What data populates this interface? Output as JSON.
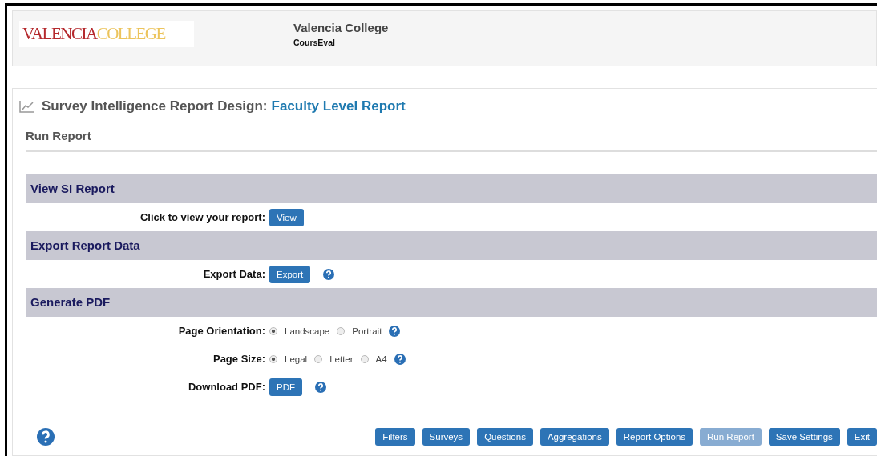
{
  "header": {
    "logo": [
      {
        "text": "VALENCIA",
        "color": "#b5292d"
      },
      {
        "text": "COLLEGE",
        "color": "#ecc45c"
      }
    ],
    "title": "Valencia College",
    "subtitle": "CoursEval"
  },
  "page": {
    "title": "Survey Intelligence Report Design:",
    "report_name": "Faculty Level Report",
    "subtitle": "Run Report"
  },
  "sections": [
    {
      "title": "View SI Report",
      "rows": [
        {
          "kind": "button",
          "label": "Click to view your report:",
          "button": "View",
          "help": false
        }
      ]
    },
    {
      "title": "Export Report Data",
      "rows": [
        {
          "kind": "button",
          "label": "Export Data:",
          "button": "Export",
          "help": true
        }
      ]
    },
    {
      "title": "Generate PDF",
      "rows": [
        {
          "kind": "radio",
          "label": "Page Orientation:",
          "options": [
            {
              "label": "Landscape",
              "selected": true
            },
            {
              "label": "Portrait",
              "selected": false
            }
          ],
          "help": true
        },
        {
          "kind": "radio",
          "label": "Page Size:",
          "options": [
            {
              "label": "Legal",
              "selected": true
            },
            {
              "label": "Letter",
              "selected": false
            },
            {
              "label": "A4",
              "selected": false
            }
          ],
          "help": true
        },
        {
          "kind": "button",
          "label": "Download PDF:",
          "button": "PDF",
          "help": true
        }
      ]
    }
  ],
  "footer_buttons": [
    {
      "label": "Filters",
      "disabled": false
    },
    {
      "label": "Surveys",
      "disabled": false
    },
    {
      "label": "Questions",
      "disabled": false
    },
    {
      "label": "Aggregations",
      "disabled": false
    },
    {
      "label": "Report Options",
      "disabled": false
    },
    {
      "label": "Run Report",
      "disabled": true
    },
    {
      "label": "Save Settings",
      "disabled": false
    },
    {
      "label": "Exit",
      "disabled": false
    }
  ]
}
